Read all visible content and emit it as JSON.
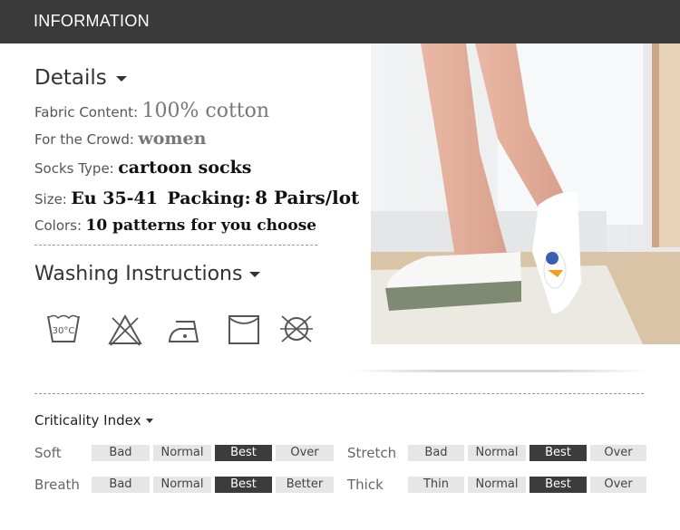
{
  "header": {
    "title": "INFORMATION"
  },
  "details": {
    "title": "Details",
    "fabric": {
      "label": "Fabric Content:",
      "value": "100% cotton"
    },
    "crowd": {
      "label": "For the Crowd:",
      "value": "women"
    },
    "type": {
      "label": "Socks Type:",
      "value": "cartoon socks"
    },
    "size": {
      "label": "Size:",
      "value": "Eu 35-41",
      "packing_label": "Packing:",
      "packing_value": "8 Pairs/lot"
    },
    "colors": {
      "label": "Colors:",
      "value": "10 patterns for you choose"
    }
  },
  "washing": {
    "title": "Washing Instructions",
    "icons": [
      "wash-30c-icon",
      "no-bleach-icon",
      "iron-low-icon",
      "tumble-dry-icon",
      "no-dry-clean-icon"
    ],
    "wash_temp": "30°C"
  },
  "criticality": {
    "title": "Criticality Index",
    "rows": [
      {
        "label": "Soft",
        "options": [
          "Bad",
          "Normal",
          "Best",
          "Over"
        ],
        "selected": "Best"
      },
      {
        "label": "Stretch",
        "options": [
          "Bad",
          "Normal",
          "Best",
          "Over"
        ],
        "selected": "Best"
      },
      {
        "label": "Breath",
        "options": [
          "Bad",
          "Normal",
          "Best",
          "Better"
        ],
        "selected": "Best"
      },
      {
        "label": "Thick",
        "options": [
          "Thin",
          "Normal",
          "Best",
          "Over"
        ],
        "selected": "Best"
      }
    ]
  },
  "colors": {
    "header_bg": "#3a3a3a",
    "active_cell": "#3c3c3c",
    "inactive_cell": "#e6e6e6"
  }
}
